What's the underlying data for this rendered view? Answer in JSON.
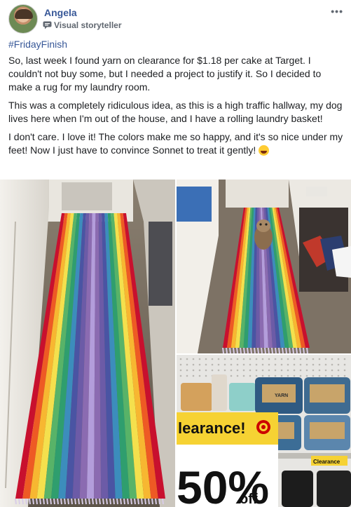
{
  "post": {
    "author": "Angela",
    "badge": "Visual storyteller",
    "more_label": "•••",
    "hashtag": "#FridayFinish",
    "paragraphs": [
      "So, last week I found yarn on clearance for $1.18 per cake at Target. I couldn't not buy some, but I needed a project to justify it. So I decided to make a rug for my laundry room.",
      "This was a completely ridiculous idea, as this is a high traffic hallway, my dog lives here when I'm out of the house, and I have a rolling laundry basket!",
      "I don't care. I love it! The colors make me so happy, and it's so nice under my feet! Now I just have to convince Sonnet to treat it gently!"
    ]
  },
  "photos": {
    "store": {
      "sign_text": "learance!",
      "discount_text": "50%",
      "discount_suffix": "off",
      "shelf_tag": "Clearance",
      "label_text": "YARN"
    }
  },
  "colors": {
    "link": "#385898",
    "rainbow": [
      "#c8102e",
      "#ee5a24",
      "#f7b731",
      "#f4e04d",
      "#58b368",
      "#2f9e6e",
      "#3c8dbc",
      "#4a54a3",
      "#6c5ba7",
      "#8b6bb1",
      "#b39ddb"
    ]
  }
}
